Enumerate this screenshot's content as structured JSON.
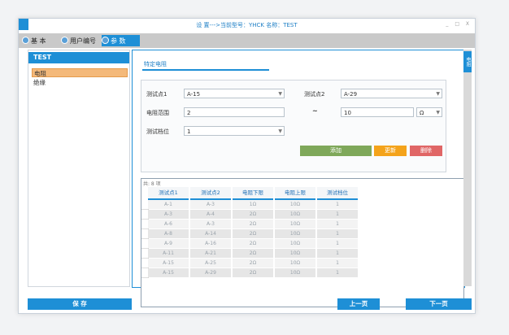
{
  "window": {
    "title": "设 置--->当前型号：YHCK 名称：TEST",
    "controls": "_ □ X"
  },
  "tabs": [
    {
      "label": "基 本"
    },
    {
      "label": "用户编号"
    },
    {
      "label": "参 数"
    }
  ],
  "left_panel": {
    "header": "TEST",
    "items": [
      "电阻",
      "绝缘"
    ]
  },
  "right_bar": {
    "label": "电阻"
  },
  "sub_tab": {
    "label": "特定电阻"
  },
  "form": {
    "point1_label": "测试点1",
    "point1_value": "A-15",
    "point2_label": "测试点2",
    "point2_value": "A-29",
    "range_label": "电阻范围",
    "range_min": "2",
    "tilde": "~",
    "range_max": "10",
    "unit": "Ω",
    "gear_label": "测试档位",
    "gear_value": "1",
    "add_label": "添加",
    "update_label": "更新",
    "delete_label": "删除"
  },
  "table": {
    "count": "共: 8 项",
    "columns": [
      "测试点1",
      "测试点2",
      "电阻下限",
      "电阻上限",
      "测试档位"
    ],
    "rows": [
      [
        "A-1",
        "A-3",
        "1Ω",
        "10Ω",
        "1"
      ],
      [
        "A-3",
        "A-4",
        "2Ω",
        "10Ω",
        "1"
      ],
      [
        "A-6",
        "A-3",
        "2Ω",
        "10Ω",
        "1"
      ],
      [
        "A-8",
        "A-14",
        "2Ω",
        "10Ω",
        "1"
      ],
      [
        "A-9",
        "A-16",
        "2Ω",
        "10Ω",
        "1"
      ],
      [
        "A-11",
        "A-21",
        "2Ω",
        "10Ω",
        "1"
      ],
      [
        "A-15",
        "A-25",
        "2Ω",
        "10Ω",
        "1"
      ],
      [
        "A-15",
        "A-29",
        "2Ω",
        "10Ω",
        "1"
      ]
    ]
  },
  "bottom": {
    "save": "保 存",
    "prev": "上一页",
    "next": "下一页"
  },
  "colors": {
    "accent": "#1e8fd6",
    "add_button": "#7fa85a",
    "update_button": "#f4a31b",
    "delete_button": "#e06666",
    "selected_item": "#f4b97a"
  }
}
